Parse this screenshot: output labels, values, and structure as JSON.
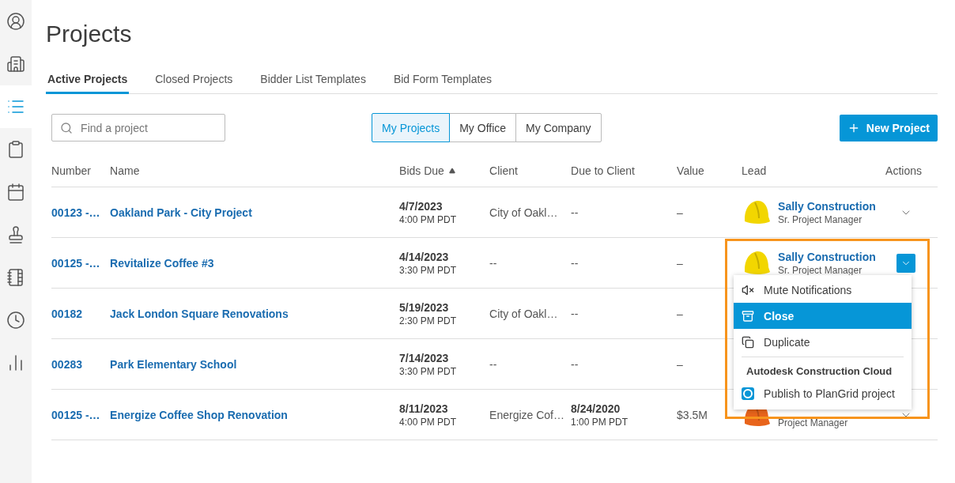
{
  "sidebar": {
    "items": [
      {
        "selected": false
      },
      {
        "selected": false
      },
      {
        "selected": true
      },
      {
        "selected": false
      },
      {
        "selected": false
      },
      {
        "selected": false
      },
      {
        "selected": false
      },
      {
        "selected": false
      },
      {
        "selected": false
      }
    ]
  },
  "title": "Projects",
  "tabs": [
    {
      "label": "Active Projects",
      "selected": true
    },
    {
      "label": "Closed Projects",
      "selected": false
    },
    {
      "label": "Bidder List Templates",
      "selected": false
    },
    {
      "label": "Bid Form Templates",
      "selected": false
    }
  ],
  "search": {
    "placeholder": "Find a project"
  },
  "scope_filter": [
    {
      "label": "My Projects",
      "selected": true
    },
    {
      "label": "My Office",
      "selected": false
    },
    {
      "label": "My Company",
      "selected": false
    }
  ],
  "new_button": {
    "label": "New Project"
  },
  "table": {
    "columns": [
      {
        "label": "Number"
      },
      {
        "label": "Name"
      },
      {
        "label": "Bids Due",
        "sorted": true
      },
      {
        "label": "Client"
      },
      {
        "label": "Due to Client"
      },
      {
        "label": "Value"
      },
      {
        "label": "Lead"
      },
      {
        "label": "Actions"
      }
    ],
    "rows": [
      {
        "number": "00123 -…",
        "name": "Oakland Park - City Project",
        "bids_due": {
          "date": "4/7/2023",
          "time": "4:00 PM PDT"
        },
        "client": "City of Oakl…",
        "due_to_client": {
          "date": "--"
        },
        "value": "–",
        "lead": {
          "name": "Sally Construction",
          "role": "Sr. Project Manager",
          "color": "#f2d600"
        },
        "actions": {
          "open": false
        }
      },
      {
        "number": "00125 -…",
        "name": "Revitalize Coffee #3",
        "bids_due": {
          "date": "4/14/2023",
          "time": "3:30 PM PDT"
        },
        "client": "--",
        "due_to_client": {
          "date": "--"
        },
        "value": "–",
        "lead": {
          "name": "Sally Construction",
          "role": "Sr. Project Manager",
          "color": "#f2d600"
        },
        "actions": {
          "open": true
        }
      },
      {
        "number": "00182",
        "name": "Jack London Square Renovations",
        "bids_due": {
          "date": "5/19/2023",
          "time": "2:30 PM PDT"
        },
        "client": "City of Oakl…",
        "due_to_client": {
          "date": "--"
        },
        "value": "–"
      },
      {
        "number": "00283",
        "name": "Park Elementary School",
        "bids_due": {
          "date": "7/14/2023",
          "time": "3:30 PM PDT"
        },
        "client": "--",
        "due_to_client": {
          "date": "--"
        },
        "value": "–"
      },
      {
        "number": "00125 -…",
        "name": "Energize Coffee Shop Renovation",
        "bids_due": {
          "date": "8/11/2023",
          "time": "4:00 PM PDT"
        },
        "client": "Energize Cof…",
        "due_to_client": {
          "date": "8/24/2020",
          "time": "1:00 PM PDT"
        },
        "value": "$3.5M",
        "lead": {
          "role": "Project Manager",
          "color": "#e8641b"
        },
        "actions": {
          "open": false
        }
      }
    ]
  },
  "actions_menu": {
    "highlighted": true,
    "items": [
      {
        "kind": "item",
        "label": "Mute Notifications",
        "selected": false
      },
      {
        "kind": "item",
        "label": "Close",
        "selected": true
      },
      {
        "kind": "item",
        "label": "Duplicate",
        "selected": false
      },
      {
        "kind": "divider"
      },
      {
        "kind": "heading",
        "label": "Autodesk Construction Cloud"
      },
      {
        "kind": "item",
        "label": "Publish to PlanGrid project",
        "selected": false
      }
    ]
  }
}
